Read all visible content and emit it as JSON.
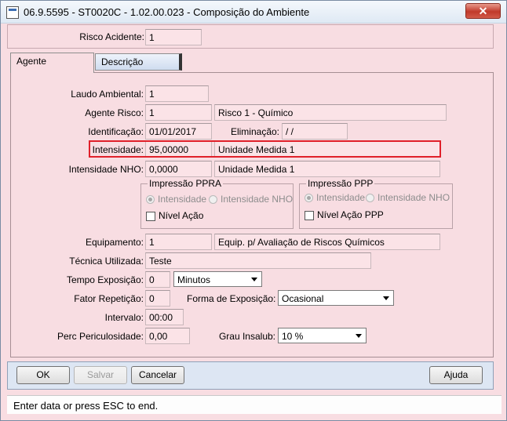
{
  "window": {
    "title": "06.9.5595 - ST0020C - 1.02.00.023 - Composição do Ambiente",
    "close_label": "✕"
  },
  "header": {
    "risco_acidente_label": "Risco Acidente:",
    "risco_acidente_value": "1"
  },
  "tabs": [
    {
      "label": "Agente",
      "active": true
    },
    {
      "label": "Descrição",
      "active": false
    }
  ],
  "form": {
    "laudo_label": "Laudo Ambiental:",
    "laudo_value": "1",
    "agente_label": "Agente Risco:",
    "agente_code": "1",
    "agente_desc": "Risco  1 - Químico",
    "identificacao_label": "Identificação:",
    "identificacao_value": "01/01/2017",
    "eliminacao_label": "Eliminação:",
    "eliminacao_value": " / /",
    "intensidade_label": "Intensidade:",
    "intensidade_value": "95,00000",
    "intensidade_unit": "Unidade Medida 1",
    "intensidade_nho_label": "Intensidade NHO:",
    "intensidade_nho_value": "0,0000",
    "intensidade_nho_unit": "Unidade Medida 1",
    "ppra": {
      "title": "Impressão PPRA",
      "opt1": "Intensidade",
      "opt2": "Intensidade NHO",
      "check": "Nível Ação"
    },
    "ppp": {
      "title": "Impressão PPP",
      "opt1": "Intensidade",
      "opt2": "Intensidade NHO",
      "check": "Nível Ação PPP"
    },
    "equipamento_label": "Equipamento:",
    "equipamento_code": "1",
    "equipamento_desc": "Equip. p/ Avaliação de Riscos Químicos",
    "tecnica_label": "Técnica Utilizada:",
    "tecnica_value": "Teste",
    "tempo_label": "Tempo Exposição:",
    "tempo_value": "0",
    "tempo_unit": "Minutos",
    "fator_label": "Fator Repetição:",
    "fator_value": "0",
    "forma_label": "Forma de Exposição:",
    "forma_value": "Ocasional",
    "intervalo_label": "Intervalo:",
    "intervalo_value": "00:00",
    "perc_label": "Perc Periculosidade:",
    "perc_value": "0,00",
    "grau_label": "Grau Insalub:",
    "grau_value": "10 %"
  },
  "buttons": {
    "ok": "OK",
    "salvar": "Salvar",
    "cancelar": "Cancelar",
    "ajuda": "Ajuda"
  },
  "status": "Enter data or press ESC to end."
}
